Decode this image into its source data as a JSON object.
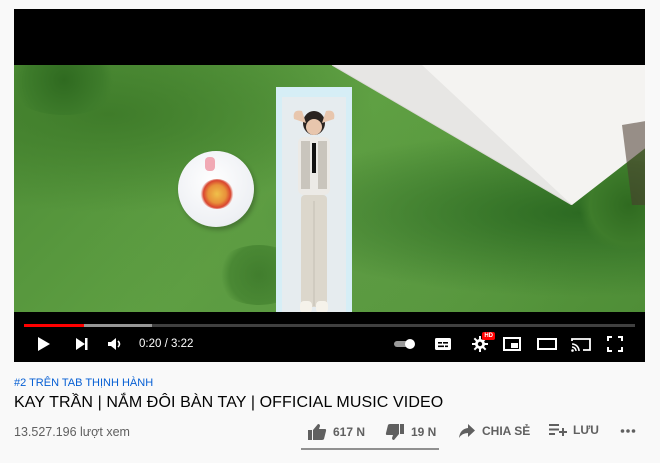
{
  "player": {
    "current_time": "0:20",
    "duration": "3:22",
    "time_separator": "/",
    "progress_played": 0.099,
    "progress_buffered": 0.21,
    "hd_badge": "HD",
    "controls": [
      "play-icon",
      "next-icon",
      "volume-icon",
      "autoplay-toggle",
      "subtitles-icon",
      "settings-icon",
      "miniplayer-icon",
      "theater-icon",
      "cast-icon",
      "fullscreen-icon"
    ]
  },
  "video": {
    "trending_tag": "#2 TRÊN TAB THỊNH HÀNH",
    "title": "KAY TRẦN | NẮM ĐÔI BÀN TAY | OFFICIAL MUSIC VIDEO",
    "views": "13.527.196 lượt xem"
  },
  "actions": {
    "like_count": "617 N",
    "dislike_count": "19 N",
    "share_label": "CHIA SẺ",
    "save_label": "LƯU"
  },
  "colors": {
    "progress": "#ff0000",
    "link": "#065fd4",
    "text_secondary": "#606060"
  }
}
